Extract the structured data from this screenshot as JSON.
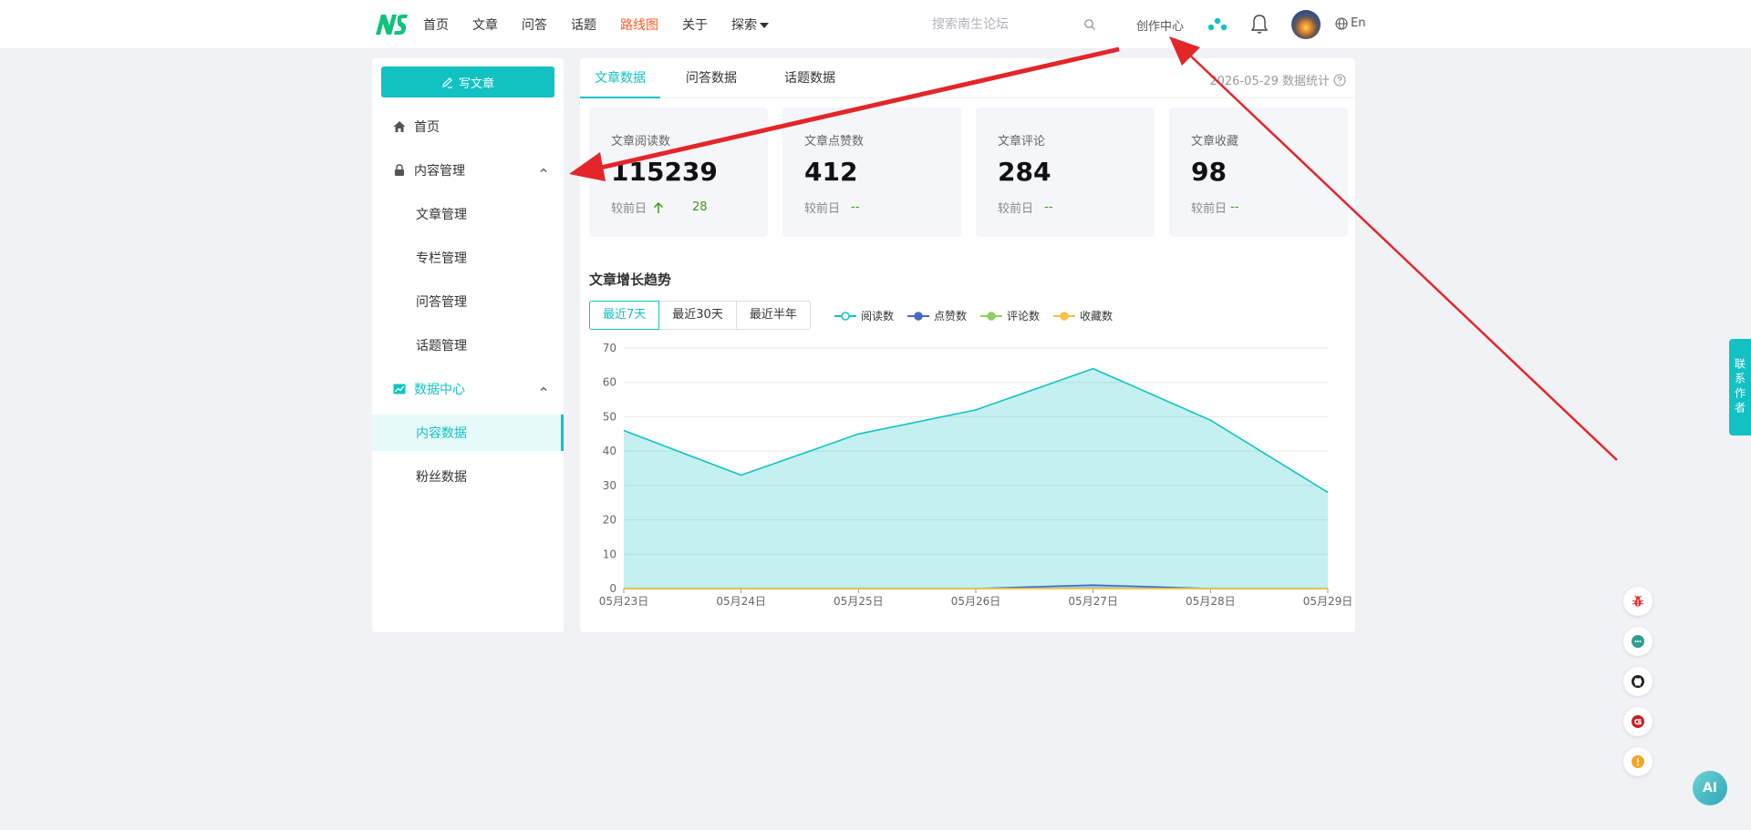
{
  "nav": {
    "items": [
      "首页",
      "文章",
      "问答",
      "话题",
      "路线图",
      "关于",
      "探索"
    ],
    "search_placeholder": "搜索南生论坛",
    "creator_center": "创作中心",
    "lang": "En"
  },
  "sidebar": {
    "write_button": "写文章",
    "home": "首页",
    "content_mgmt": "内容管理",
    "content_items": [
      "文章管理",
      "专栏管理",
      "问答管理",
      "话题管理"
    ],
    "data_center": "数据中心",
    "data_items": [
      "内容数据",
      "粉丝数据"
    ]
  },
  "main": {
    "tabs": [
      "文章数据",
      "问答数据",
      "话题数据"
    ],
    "stat_date": "2026-05-29 数据统计",
    "cards": [
      {
        "title": "文章阅读数",
        "value": "115239",
        "cmp_label": "较前日",
        "delta": "28"
      },
      {
        "title": "文章点赞数",
        "value": "412",
        "cmp_label": "较前日",
        "delta": "--"
      },
      {
        "title": "文章评论",
        "value": "284",
        "cmp_label": "较前日",
        "delta": "--"
      },
      {
        "title": "文章收藏",
        "value": "98",
        "cmp_label": "较前日",
        "delta": "--"
      }
    ],
    "chart_title": "文章增长趋势",
    "ranges": [
      "最近7天",
      "最近30天",
      "最近半年"
    ],
    "legend": [
      "阅读数",
      "点赞数",
      "评论数",
      "收藏数"
    ]
  },
  "chart_data": {
    "type": "area",
    "x": [
      "05月23日",
      "05月24日",
      "05月25日",
      "05月26日",
      "05月27日",
      "05月28日",
      "05月29日"
    ],
    "ylim": [
      0,
      70
    ],
    "yticks": [
      0,
      10,
      20,
      30,
      40,
      50,
      60,
      70
    ],
    "series": [
      {
        "name": "阅读数",
        "color": "#12c2c3",
        "values": [
          46,
          33,
          45,
          52,
          64,
          49,
          28
        ]
      },
      {
        "name": "点赞数",
        "color": "#4a67c1",
        "values": [
          0,
          0,
          0,
          0,
          1,
          0,
          0
        ]
      },
      {
        "name": "评论数",
        "color": "#8fce5c",
        "values": [
          0,
          0,
          0,
          0,
          0,
          0,
          0
        ]
      },
      {
        "name": "收藏数",
        "color": "#f5c342",
        "values": [
          0,
          0,
          0,
          0,
          0,
          0,
          0
        ]
      }
    ]
  },
  "floating": {
    "contact": "联系作者",
    "ai": "AI"
  },
  "colors": {
    "accent": "#12c2c3",
    "roadmap": "#ff5a1f",
    "annotation_arrow": "#e3262a"
  }
}
